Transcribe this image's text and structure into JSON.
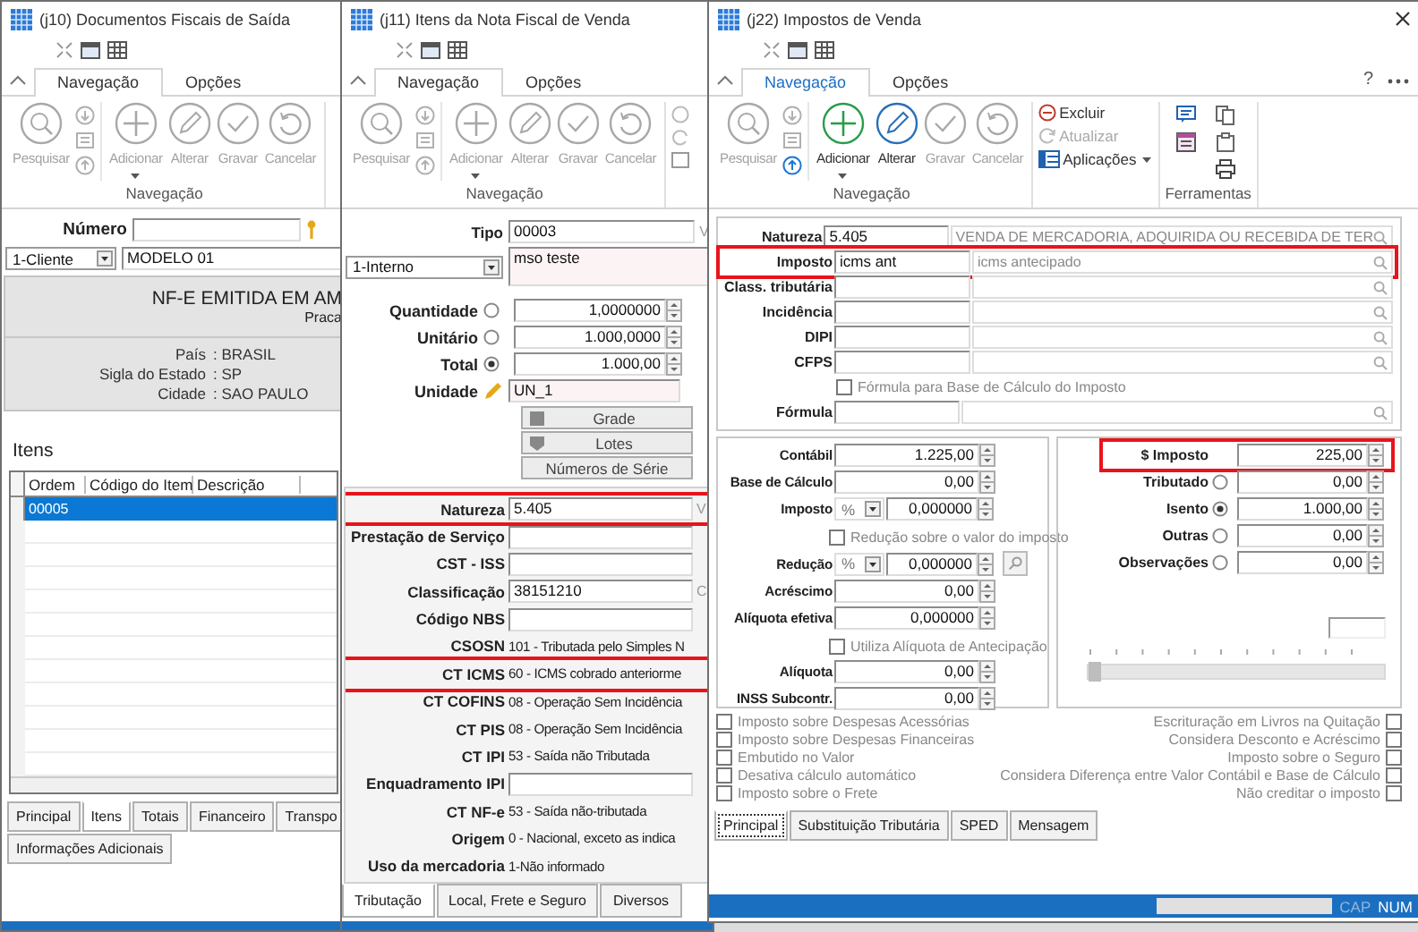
{
  "windows": [
    {
      "kind": "documents",
      "title": "(j10) Documentos Fiscais de Saída",
      "active": false,
      "ribbon": {
        "tabs": [
          {
            "label": "Navegação",
            "selected": true
          },
          {
            "label": "Opções",
            "selected": false
          }
        ],
        "nav": [
          {
            "label": "Pesquisar",
            "disabled": true
          },
          {
            "label": "Adicionar",
            "disabled": true
          },
          {
            "label": "Alterar",
            "disabled": true
          },
          {
            "label": "Gravar",
            "disabled": true
          },
          {
            "label": "Cancelar",
            "disabled": true
          }
        ],
        "record_arrows": [
          {
            "disabled": true
          },
          {
            "disabled": true
          },
          {
            "disabled": true
          }
        ],
        "group_label": "Navegação"
      },
      "numero": {
        "label": "Número"
      },
      "cliente": {
        "type": "1-Cliente",
        "model": "MODELO 01"
      },
      "header": {
        "title": "NF-E EMITIDA EM AM",
        "subtitle": "Praca",
        "lines": [
          {
            "label": "País",
            "value": ": BRASIL"
          },
          {
            "label": "Sigla do Estado",
            "value": ": SP"
          },
          {
            "label": "Cidade",
            "value": ": SAO PAULO"
          }
        ]
      },
      "items": {
        "title": "Itens",
        "columns": [
          "Ordem",
          "Código do Item",
          "Descrição"
        ],
        "rows": [
          {
            "ordem": "00005",
            "selected": true
          }
        ]
      },
      "tab_rows": [
        {
          "tabs": [
            {
              "label": "Principal",
              "selected": false
            },
            {
              "label": "Itens",
              "selected": true
            },
            {
              "label": "Totais",
              "selected": false
            },
            {
              "label": "Financeiro",
              "selected": false
            },
            {
              "label": "Transpo",
              "selected": false
            }
          ]
        },
        {
          "tabs": [
            {
              "label": "Informações Adicionais",
              "selected": false
            }
          ]
        }
      ]
    },
    {
      "kind": "items",
      "title": "(j11) Itens da Nota Fiscal de Venda",
      "active": false,
      "ribbon": {
        "tabs": [
          {
            "label": "Navegação",
            "selected": true
          },
          {
            "label": "Opções",
            "selected": false
          }
        ],
        "nav": [
          {
            "label": "Pesquisar",
            "disabled": true
          },
          {
            "label": "Adicionar",
            "disabled": true
          },
          {
            "label": "Alterar",
            "disabled": true
          },
          {
            "label": "Gravar",
            "disabled": true
          },
          {
            "label": "Cancelar",
            "disabled": true
          }
        ],
        "record_arrows": [
          {
            "disabled": true
          },
          {
            "disabled": true
          },
          {
            "disabled": true
          }
        ],
        "group_label": "Navegação"
      },
      "tipo": {
        "label": "Tipo",
        "value": "00003",
        "side": "V"
      },
      "origin": {
        "value": "1-Interno",
        "description": "mso teste"
      },
      "quantities": [
        {
          "label": "Quantidade",
          "value": "1,0000000",
          "selected": false
        },
        {
          "label": "Unitário",
          "value": "1.000,0000",
          "selected": false
        },
        {
          "label": "Total",
          "value": "1.000,00",
          "selected": true
        }
      ],
      "unidade": {
        "label": "Unidade",
        "value": "UN_1"
      },
      "buttons": [
        {
          "label": "Grade"
        },
        {
          "label": "Lotes"
        },
        {
          "label": "Números de Série"
        }
      ],
      "fields": [
        {
          "kind": "input",
          "label": "Natureza",
          "value": "5.405",
          "side": "V",
          "highlighted": true
        },
        {
          "kind": "input",
          "label": "Prestação de Serviço",
          "highlighted": false
        },
        {
          "kind": "input",
          "label": "CST - ISS",
          "highlighted": false
        },
        {
          "kind": "input",
          "label": "Classificação",
          "value": "38151210",
          "side": "C",
          "highlighted": false
        },
        {
          "kind": "input",
          "label": "Código NBS",
          "highlighted": false
        },
        {
          "kind": "display",
          "label": "CSOSN",
          "value": "101 - Tributada pelo Simples N",
          "highlighted": false
        },
        {
          "kind": "display",
          "label": "CT ICMS",
          "value": "60 - ICMS cobrado anteriorme",
          "highlighted": true
        },
        {
          "kind": "display",
          "label": "CT COFINS",
          "value": "08 - Operação Sem Incidência",
          "highlighted": false
        },
        {
          "kind": "display",
          "label": "CT PIS",
          "value": "08 - Operação Sem Incidência",
          "highlighted": false
        },
        {
          "kind": "display",
          "label": "CT IPI",
          "value": "53 - Saída não Tributada",
          "highlighted": false
        },
        {
          "kind": "input",
          "label": "Enquadramento IPI",
          "highlighted": false
        },
        {
          "kind": "display",
          "label": "CT NF-e",
          "value": "53 - Saída não-tributada",
          "highlighted": false
        },
        {
          "kind": "display",
          "label": "Origem",
          "value": "0 - Nacional, exceto as indica",
          "highlighted": false
        },
        {
          "kind": "display",
          "label": "Uso da mercadoria",
          "value": "1-Não informado",
          "highlighted": false
        }
      ],
      "tab_rows": [
        {
          "tabs": [
            {
              "label": "Tributação",
              "selected": true
            },
            {
              "label": "Local, Frete e Seguro",
              "selected": false
            },
            {
              "label": "Diversos",
              "selected": false
            }
          ]
        }
      ]
    },
    {
      "kind": "taxes",
      "title": "(j22) Impostos de Venda",
      "active": true,
      "ribbon": {
        "tabs": [
          {
            "label": "Navegação",
            "selected": true
          },
          {
            "label": "Opções",
            "selected": false
          }
        ],
        "help": "?",
        "nav": [
          {
            "label": "Pesquisar",
            "disabled": true
          },
          {
            "label": "Adicionar",
            "disabled": false
          },
          {
            "label": "Alterar",
            "disabled": false
          },
          {
            "label": "Gravar",
            "disabled": true
          },
          {
            "label": "Cancelar",
            "disabled": true
          }
        ],
        "record_arrows": [
          {
            "disabled": true
          },
          {
            "disabled": true
          },
          {
            "disabled": false
          }
        ],
        "group_label": "Navegação",
        "actions": [
          {
            "label": "Excluir",
            "disabled": false
          },
          {
            "label": "Atualizar",
            "disabled": true
          },
          {
            "label": "Aplicações",
            "disabled": false
          }
        ],
        "tools_label": "Ferramentas"
      },
      "lookups": [
        {
          "label": "Natureza",
          "code": "5.405",
          "description": "VENDA DE MERCADORIA, ADQUIRIDA OU RECEBIDA DE TER",
          "highlighted": false
        },
        {
          "label": "Imposto",
          "code": "icms ant",
          "description": "icms antecipado",
          "highlighted": true
        },
        {
          "label": "Class. tributária",
          "highlighted": false
        },
        {
          "label": "Incidência",
          "highlighted": false
        },
        {
          "label": "DIPI",
          "highlighted": false
        },
        {
          "label": "CFPS",
          "highlighted": false
        }
      ],
      "formula_option": {
        "label": "Fórmula para Base de Cálculo do Imposto",
        "checked": false
      },
      "formula": {
        "label": "Fórmula"
      },
      "values": [
        {
          "kind": "number",
          "label": "Contábil",
          "value": "1.225,00"
        },
        {
          "kind": "number",
          "label": "Base de Cálculo",
          "value": "0,00"
        },
        {
          "kind": "percent",
          "label": "Imposto",
          "unit": "%",
          "value": "0,000000"
        },
        {
          "kind": "checkbox",
          "label": "Redução sobre o valor do imposto",
          "checked": false
        },
        {
          "kind": "percent",
          "label": "Redução",
          "unit": "%",
          "value": "0,000000"
        },
        {
          "kind": "number",
          "label": "Acréscimo",
          "value": "0,00"
        },
        {
          "kind": "number",
          "label": "Alíquota efetiva",
          "value": "0,000000"
        },
        {
          "kind": "checkbox",
          "label": "Utiliza Alíquota de Antecipação",
          "checked": false
        },
        {
          "kind": "number",
          "label": "Alíquota",
          "value": "0,00"
        },
        {
          "kind": "number",
          "label": "INSS Subcontr.",
          "value": "0,00"
        }
      ],
      "amount": {
        "label": "$ Imposto",
        "value": "225,00",
        "highlighted": true
      },
      "distribution": [
        {
          "label": "Tributado",
          "value": "0,00",
          "selected": false
        },
        {
          "label": "Isento",
          "value": "1.000,00",
          "selected": true
        },
        {
          "label": "Outras",
          "value": "0,00",
          "selected": false
        },
        {
          "label": "Observações",
          "value": "0,00",
          "selected": false
        }
      ],
      "slider": {
        "level": 0
      },
      "options_left": [
        {
          "label": "Imposto sobre Despesas Acessórias",
          "checked": false
        },
        {
          "label": "Imposto sobre Despesas Financeiras",
          "checked": false
        },
        {
          "label": "Embutido no Valor",
          "checked": false
        },
        {
          "label": "Desativa cálculo automático",
          "checked": false
        },
        {
          "label": "Imposto sobre o Frete",
          "checked": false
        }
      ],
      "options_right": [
        {
          "label": "Escrituração em Livros na Quitação",
          "checked": false
        },
        {
          "label": "Considera Desconto e Acréscimo",
          "checked": false
        },
        {
          "label": "Imposto sobre o Seguro",
          "checked": false
        },
        {
          "label": "Considera Diferença entre Valor Contábil e Base de Cálculo",
          "checked": false
        },
        {
          "label": "Não creditar o imposto",
          "checked": false
        }
      ],
      "tab_rows": [
        {
          "tabs": [
            {
              "label": "Principal",
              "selected": true
            },
            {
              "label": "Substituição Tributária",
              "selected": false
            },
            {
              "label": "SPED",
              "selected": false
            },
            {
              "label": "Mensagem",
              "selected": false
            }
          ]
        }
      ],
      "status_bar": {
        "indicators": [
          {
            "label": "CAP",
            "on": false
          },
          {
            "label": "NUM",
            "on": true
          }
        ]
      }
    }
  ]
}
